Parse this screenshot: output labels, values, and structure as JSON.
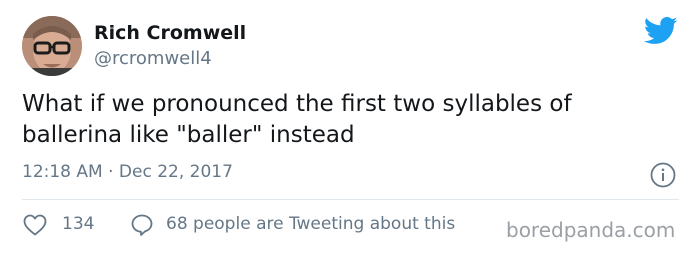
{
  "author": {
    "display_name": "Rich Cromwell",
    "handle": "@rcromwell4"
  },
  "tweet": {
    "text": "What if we pronounced the first two syllables of ballerina like \"baller\" instead",
    "timestamp": "12:18 AM · Dec 22, 2017"
  },
  "engagement": {
    "likes": "134",
    "conversation": "68 people are Tweeting about this"
  },
  "watermark": "boredpanda.com",
  "icons": {
    "brand": "twitter-bird-icon",
    "info": "info-icon",
    "like": "heart-icon",
    "reply": "reply-bubble-icon"
  },
  "colors": {
    "twitter_blue": "#1da1f2",
    "text_primary": "#14171a",
    "text_secondary": "#657786",
    "divider": "#e1e8ed",
    "watermark": "#9aa0a6"
  }
}
